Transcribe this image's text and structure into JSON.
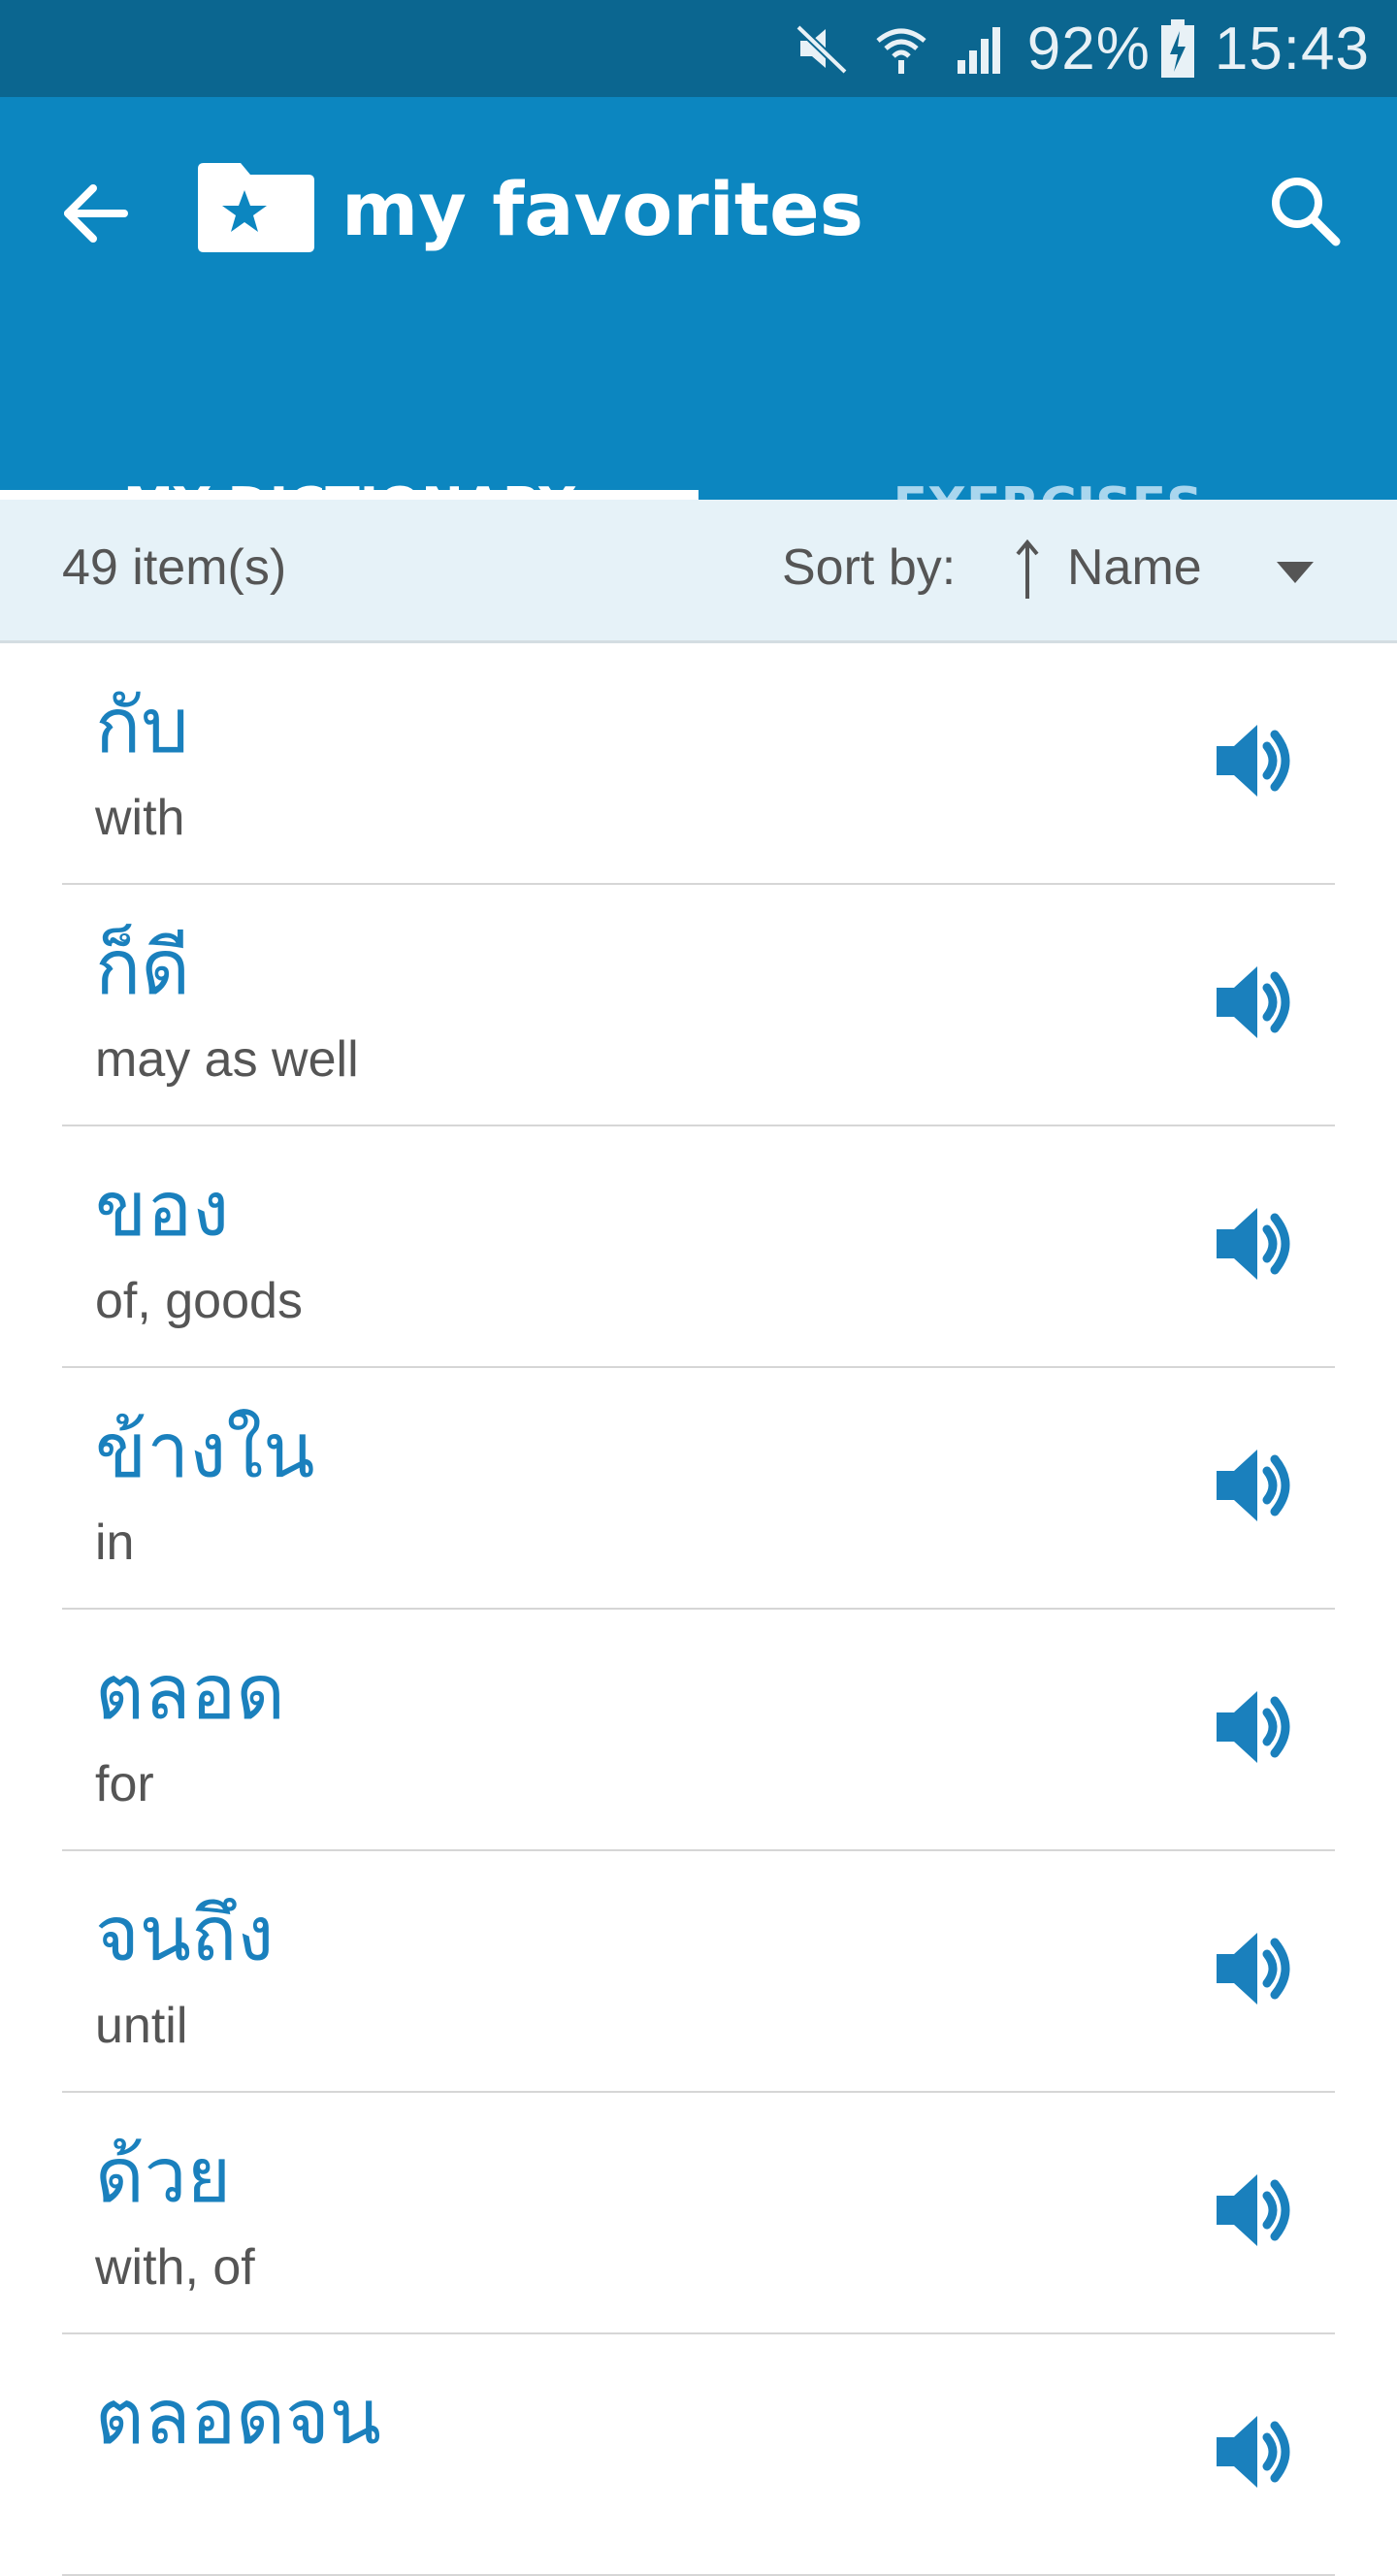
{
  "status_bar": {
    "battery": "92%",
    "time": "15:43",
    "icons": [
      "mute-icon",
      "wifi-icon",
      "signal-icon",
      "battery-charging-icon"
    ]
  },
  "app_bar": {
    "title": "my favorites",
    "back_icon": "arrow-left-icon",
    "folder_icon": "star-folder-icon",
    "search_icon": "search-icon",
    "background_color": "#0c86c0"
  },
  "tabs": [
    {
      "label": "MY DICTIONARY",
      "active": true
    },
    {
      "label": "EXERCISES",
      "active": false
    }
  ],
  "sort_bar": {
    "count": "49 item(s)",
    "sort_label": "Sort by:",
    "sort_value": "Name",
    "sort_icon": "sort-ascending-icon",
    "dropdown_icon": "caret-down-icon"
  },
  "entries": [
    {
      "thai": "กับ",
      "meaning": "with"
    },
    {
      "thai": "ก็ดี",
      "meaning": "may as well"
    },
    {
      "thai": "ของ",
      "meaning": "of, goods"
    },
    {
      "thai": "ข้างใน",
      "meaning": "in"
    },
    {
      "thai": "ตลอด",
      "meaning": "for"
    },
    {
      "thai": "จนถึง",
      "meaning": "until"
    },
    {
      "thai": "ด้วย",
      "meaning": "with, of"
    },
    {
      "thai": "ตลอดจน",
      "meaning": ""
    }
  ],
  "colors": {
    "accent": "#0c86c0",
    "status_bar": "#0b6690",
    "thai_text": "#1a80bd",
    "sort_bar_bg": "#e6f2f8"
  }
}
